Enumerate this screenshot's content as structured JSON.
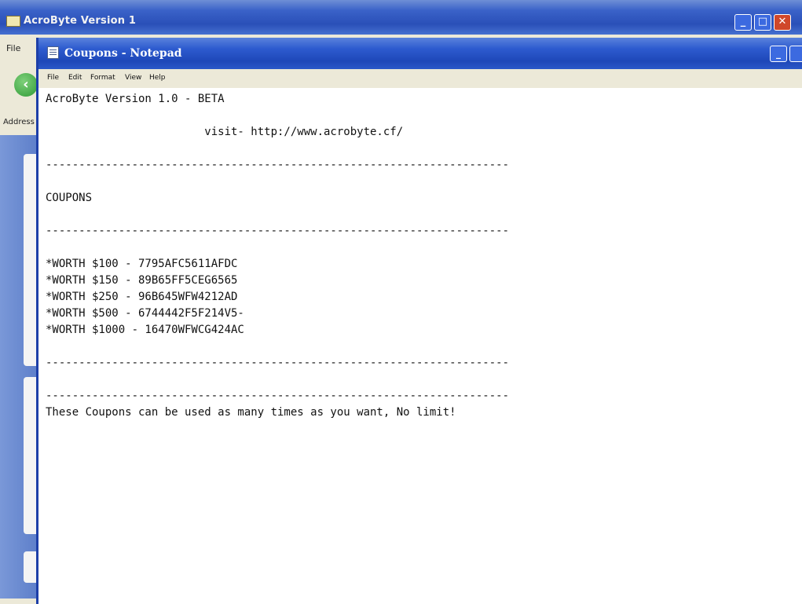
{
  "background_window": {
    "title": "AcroByte Version 1",
    "menu_file": "File",
    "address_label": "Address"
  },
  "notepad": {
    "title": "Coupons - Notepad",
    "menu": [
      "File",
      "Edit",
      "Format",
      "View",
      "Help"
    ],
    "lines": [
      "AcroByte Version 1.0 - BETA",
      "",
      "                        visit- http://www.acrobyte.cf/",
      "",
      "----------------------------------------------------------------------",
      "",
      "COUPONS",
      "",
      "----------------------------------------------------------------------",
      "",
      "*WORTH $100 - 7795AFC5611AFDC",
      "*WORTH $150 - 89B65FF5CEG6565",
      "*WORTH $250 - 96B645WFW4212AD",
      "*WORTH $500 - 6744442F5F214V5-",
      "*WORTH $1000 - 16470WFWCG424AC",
      "",
      "----------------------------------------------------------------------",
      "",
      "----------------------------------------------------------------------",
      "These Coupons can be used as many times as you want, No limit!"
    ]
  },
  "icons": {
    "back": "back-arrow-icon",
    "app": "app-icon",
    "notepad": "notepad-icon"
  }
}
